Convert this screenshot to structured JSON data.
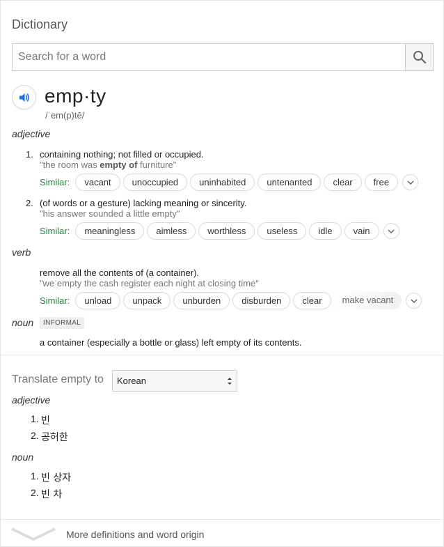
{
  "card": {
    "title": "Dictionary"
  },
  "search": {
    "placeholder": "Search for a word",
    "button_icon": "magnifier-icon"
  },
  "entry": {
    "word": "emp·ty",
    "phonetic": "/ˈem(p)tē/",
    "speaker_icon": "speaker-icon"
  },
  "senses": [
    {
      "pos": "adjective",
      "definitions": [
        {
          "number": "1.",
          "text": "containing nothing; not filled or occupied.",
          "example_pre": "\"the room was ",
          "example_bold": "empty of",
          "example_post": " furniture\"",
          "similar_label": "Similar:",
          "similar": [
            "vacant",
            "unoccupied",
            "uninhabited",
            "untenanted",
            "clear",
            "free"
          ]
        },
        {
          "number": "2.",
          "text": "(of words or a gesture) lacking meaning or sincerity.",
          "example": "\"his answer sounded a little empty\"",
          "similar_label": "Similar:",
          "similar": [
            "meaningless",
            "aimless",
            "worthless",
            "useless",
            "idle",
            "vain"
          ]
        }
      ]
    },
    {
      "pos": "verb",
      "definitions": [
        {
          "text": "remove all the contents of (a container).",
          "example": "\"we empty the cash register each night at closing time\"",
          "similar_label": "Similar:",
          "similar": [
            "unload",
            "unpack",
            "unburden",
            "disburden",
            "clear",
            "make vacant"
          ]
        }
      ]
    },
    {
      "pos": "noun",
      "badge": "INFORMAL",
      "definitions": [
        {
          "text": "a container (especially a bottle or glass) left empty of its contents."
        }
      ]
    }
  ],
  "translate": {
    "label": "Translate empty to",
    "language": "Korean",
    "groups": [
      {
        "pos": "adjective",
        "items": [
          {
            "n": "1.",
            "t": "빈"
          },
          {
            "n": "2.",
            "t": "공허한"
          }
        ]
      },
      {
        "pos": "noun",
        "items": [
          {
            "n": "1.",
            "t": "빈 상자"
          },
          {
            "n": "2.",
            "t": "빈 차"
          }
        ]
      }
    ]
  },
  "footer": {
    "more_label": "More definitions and word origin"
  },
  "colors": {
    "similar_green": "#1f8a3d",
    "speaker_blue": "#1a73e8",
    "accent_grey": "#777777"
  }
}
